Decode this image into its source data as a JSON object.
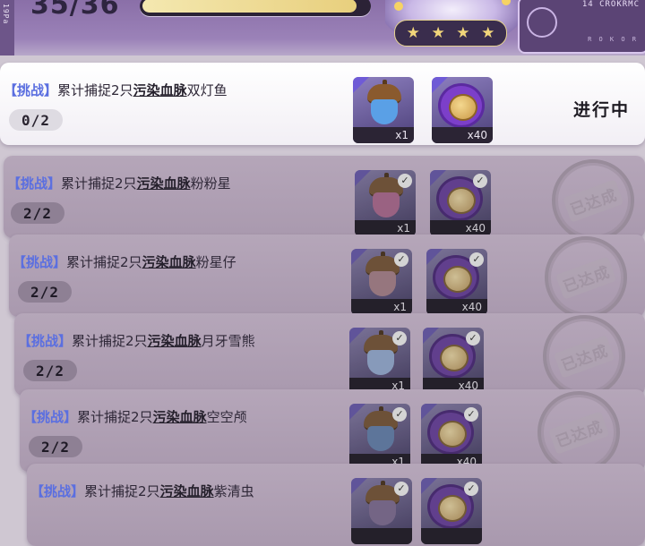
{
  "header": {
    "side_label": "19Pa",
    "counter": "35/36",
    "progress_fraction": 0.95,
    "stars": [
      "★",
      "★",
      "★",
      "★"
    ],
    "emblem_code_top": "14 CROKRMC",
    "emblem_code_bottom": "R O K O R"
  },
  "tasks": [
    {
      "tag": "【挑战】",
      "prefix": "累计捕捉2只",
      "highlight": "污染血脉",
      "target": "双灯鱼",
      "progress": "0/2",
      "state": "active",
      "status": "进行中",
      "rewards": [
        {
          "icon": "acorn-icon",
          "quantity": "x1",
          "claimed": false
        },
        {
          "icon": "coin-icon",
          "quantity": "x40",
          "claimed": false
        }
      ]
    },
    {
      "tag": "【挑战】",
      "prefix": "累计捕捉2只",
      "highlight": "污染血脉",
      "target": "粉粉星",
      "progress": "2/2",
      "state": "done",
      "status": "已达成",
      "rewards": [
        {
          "icon": "acorn-icon",
          "quantity": "x1",
          "claimed": true
        },
        {
          "icon": "coin-icon",
          "quantity": "x40",
          "claimed": true
        }
      ]
    },
    {
      "tag": "【挑战】",
      "prefix": "累计捕捉2只",
      "highlight": "污染血脉",
      "target": "粉星仔",
      "progress": "2/2",
      "state": "done",
      "status": "已达成",
      "rewards": [
        {
          "icon": "acorn-icon",
          "quantity": "x1",
          "claimed": true
        },
        {
          "icon": "coin-icon",
          "quantity": "x40",
          "claimed": true
        }
      ]
    },
    {
      "tag": "【挑战】",
      "prefix": "累计捕捉2只",
      "highlight": "污染血脉",
      "target": "月牙雪熊",
      "progress": "2/2",
      "state": "done",
      "status": "已达成",
      "rewards": [
        {
          "icon": "acorn-icon",
          "quantity": "x1",
          "claimed": true
        },
        {
          "icon": "coin-icon",
          "quantity": "x40",
          "claimed": true
        }
      ]
    },
    {
      "tag": "【挑战】",
      "prefix": "累计捕捉2只",
      "highlight": "污染血脉",
      "target": "空空颅",
      "progress": "2/2",
      "state": "done",
      "status": "已达成",
      "rewards": [
        {
          "icon": "acorn-icon",
          "quantity": "x1",
          "claimed": true
        },
        {
          "icon": "coin-icon",
          "quantity": "x40",
          "claimed": true
        }
      ]
    },
    {
      "tag": "【挑战】",
      "prefix": "累计捕捉2只",
      "highlight": "污染血脉",
      "target": "紫清虫",
      "progress": "",
      "state": "done",
      "status": "",
      "rewards": [
        {
          "icon": "acorn-icon",
          "quantity": "",
          "claimed": true
        },
        {
          "icon": "coin-icon",
          "quantity": "",
          "claimed": true
        }
      ]
    }
  ],
  "colors": {
    "tag": "#5b6fe0",
    "active_row": "#ffffff",
    "done_row": "#b0a1b4",
    "acorn_bodies": [
      "#5aa0e6",
      "#c9679f",
      "#b9828f",
      "#8fb0e8",
      "#5c86c8",
      "#8a6fa8"
    ]
  }
}
